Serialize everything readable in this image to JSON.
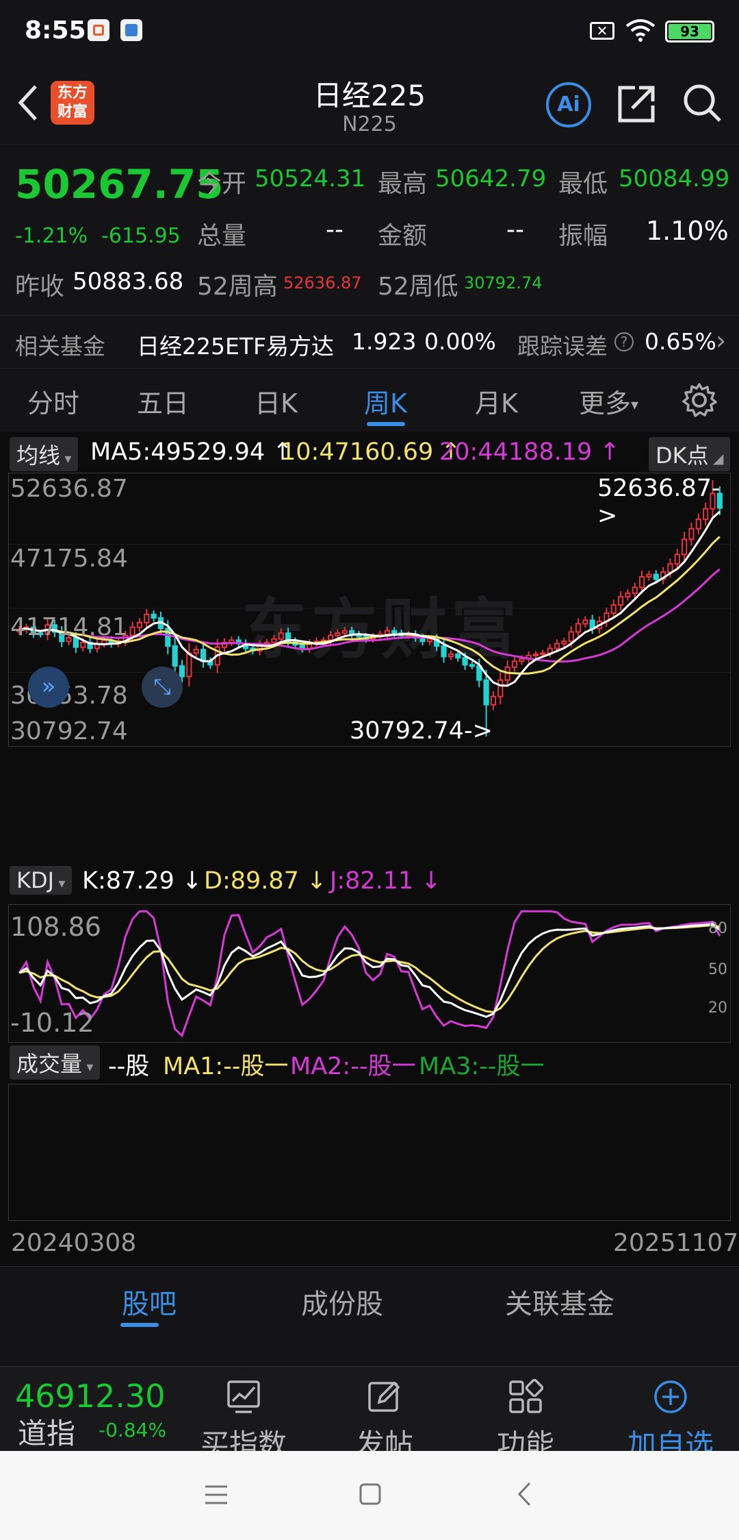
{
  "status_bar": {
    "time": "8:55",
    "battery": "93"
  },
  "header": {
    "title": "日经225",
    "code": "N225",
    "logo_text_1": "东方",
    "logo_text_2": "财富",
    "ai_label": "Ai"
  },
  "quote": {
    "price": "50267.75",
    "change_pct": "-1.21%",
    "change_abs": "-615.95",
    "open_label": "今开",
    "open": "50524.31",
    "high_label": "最高",
    "high": "50642.79",
    "low_label": "最低",
    "low": "50084.99",
    "volume_label": "总量",
    "volume": "--",
    "amount_label": "金额",
    "amount": "--",
    "amplitude_label": "振幅",
    "amplitude": "1.10%",
    "prev_close_label": "昨收",
    "prev_close": "50883.68",
    "wk52_high_label": "52周高",
    "wk52_high": "52636.87",
    "wk52_low_label": "52周低",
    "wk52_low": "30792.74"
  },
  "fund": {
    "label": "相关基金",
    "name": "日经225ETF易方达",
    "price": "1.923",
    "change": "0.00%",
    "track_label": "跟踪误差",
    "track_value": "0.65%",
    "help_icon": "?",
    "arrow": "›"
  },
  "tabs": [
    {
      "label": "分时"
    },
    {
      "label": "五日"
    },
    {
      "label": "日K"
    },
    {
      "label": "周K"
    },
    {
      "label": "月K"
    },
    {
      "label": "更多"
    }
  ],
  "main_chart": {
    "indicator_label": "均线",
    "ma5": "MA5:49529.94 ↑",
    "ma10": "10:47160.69 ↑",
    "ma20": "20:44188.19 ↑",
    "dk_label": "DK点",
    "y_labels": [
      "52636.87",
      "47175.84",
      "41714.81",
      "36253.78",
      "30792.74"
    ],
    "max_marker": "52636.87->",
    "min_marker": "30792.74->",
    "watermark": "东方财富"
  },
  "kdj": {
    "label": "KDJ",
    "k": "K:87.29 ↓",
    "d": "D:89.87 ↓",
    "j": "J:82.11 ↓",
    "y_top": "108.86",
    "y_bottom": "-10.12",
    "lvl_80": "80",
    "lvl_50": "50",
    "lvl_20": "20"
  },
  "volume_panel": {
    "label": "成交量",
    "unit": "--股",
    "ma1": "MA1:--股一",
    "ma2": "MA2:--股一",
    "ma3": "MA3:--股一"
  },
  "date_range": {
    "start": "20240308",
    "end": "20251107"
  },
  "bottom_tabs": [
    {
      "label": "股吧"
    },
    {
      "label": "成份股"
    },
    {
      "label": "关联基金"
    }
  ],
  "toolbar": {
    "index_price": "46912.30",
    "index_name": "道指",
    "index_change": "-0.84%",
    "buy_label": "买指数",
    "post_label": "发帖",
    "func_label": "功能",
    "add_label": "加自选"
  },
  "colors": {
    "up": "#e8333b",
    "down": "#19c832",
    "candle_down_fill": "#22d3d3",
    "ma5": "#ffffff",
    "ma10": "#f2e36b",
    "ma20": "#d63ad6",
    "accent": "#3a8ee6"
  },
  "chart_data": {
    "type": "candlestick",
    "period": "weekly",
    "ylim": [
      30792.74,
      52636.87
    ],
    "max": 52636.87,
    "min": 30792.74,
    "ma": {
      "MA5": 49529.94,
      "MA10": 47160.69,
      "MA20": 44188.19
    },
    "kdj": {
      "K": 87.29,
      "D": 89.87,
      "J": 82.11
    },
    "kdj_ylim": [
      -10.12,
      108.86
    ],
    "x_range": [
      "20240308",
      "20251107"
    ],
    "close_series": [
      39900,
      40100,
      39600,
      39500,
      40300,
      39700,
      38900,
      39200,
      38400,
      38800,
      38300,
      38700,
      39000,
      38700,
      38900,
      39400,
      40100,
      40500,
      41200,
      40900,
      40000,
      38500,
      36800,
      35900,
      37900,
      38200,
      37200,
      36900,
      38400,
      38800,
      39000,
      38700,
      38300,
      38100,
      38600,
      38800,
      39100,
      39600,
      38900,
      38600,
      38300,
      38700,
      38900,
      39000,
      39400,
      39600,
      39800,
      39500,
      39300,
      39100,
      39300,
      39500,
      39800,
      39600,
      39400,
      39500,
      39200,
      38900,
      39100,
      38500,
      37600,
      37800,
      37500,
      36900,
      36800,
      35600,
      33500,
      34200,
      35600,
      36700,
      37200,
      37400,
      37700,
      37800,
      37900,
      38300,
      38700,
      38900,
      39700,
      40400,
      40700,
      40000,
      40600,
      41300,
      42000,
      42700,
      43000,
      43500,
      44400,
      44600,
      44200,
      44800,
      45500,
      46300,
      47600,
      48500,
      49300,
      50200,
      51500,
      50268
    ]
  }
}
